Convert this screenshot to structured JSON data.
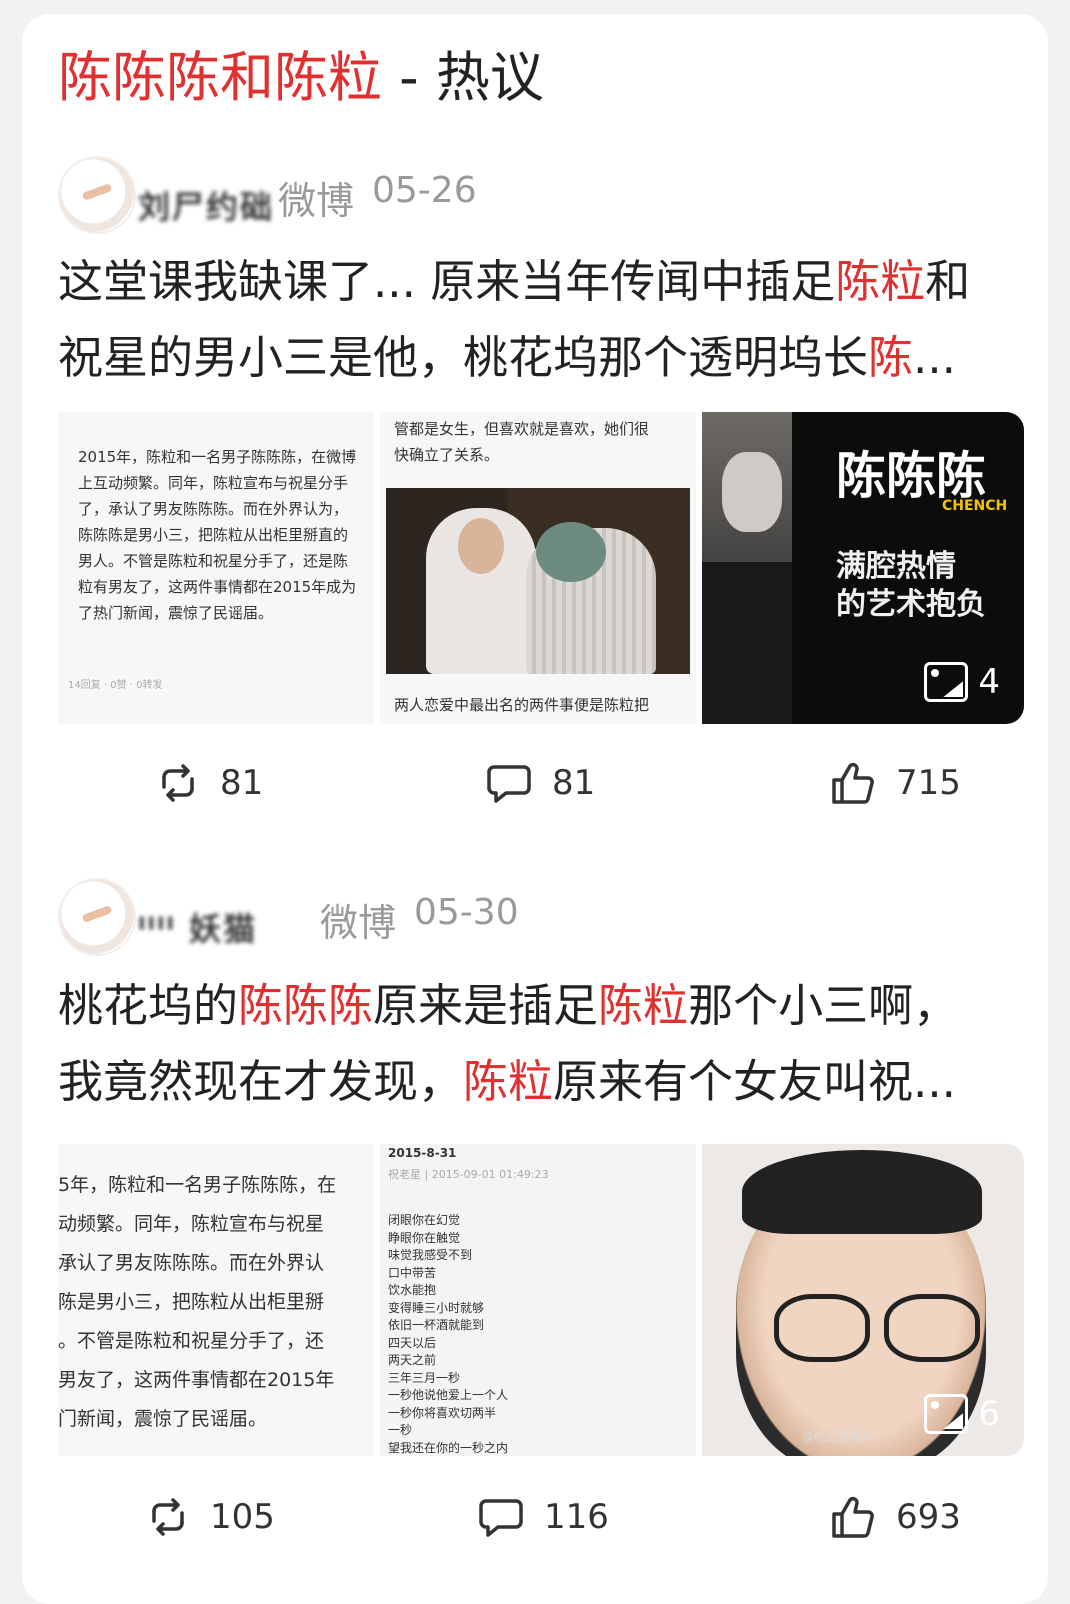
{
  "header": {
    "title_highlight": "陈陈陈和陈粒",
    "title_rest": " - 热议"
  },
  "posts": [
    {
      "user_name": "刘尸约础",
      "source": "微博",
      "date": "05-26",
      "text_lines": [
        [
          "这堂课我缺课了... 原来当年传闻中插足",
          "陈粒",
          "和"
        ],
        [
          "祝星的男小三是他，桃花坞那个透明坞长",
          "陈",
          "..."
        ]
      ],
      "images": {
        "doc1": [
          "2015年，陈粒和一名男子陈陈陈，在微博",
          "上互动频繁。同年，陈粒宣布与祝星分手",
          "了，承认了男友陈陈陈。而在外界认为，",
          "陈陈陈是男小三，把陈粒从出柜里掰直的",
          "男人。不管是陈粒和祝星分手了，还是陈",
          "粒有男友了，这两件事情都在2015年成为",
          "了热门新闻，震惊了民谣届。"
        ],
        "doc1_meta": "14回复 · 0赞 · 0转发",
        "doc2_top": [
          "管都是女生，但喜欢就是喜欢，她们很",
          "快确立了关系。"
        ],
        "doc2_bottom": "两人恋爱中最出名的两件事便是陈粒把",
        "poster_title": "陈陈陈",
        "poster_sub": "CHENCH",
        "poster_mid": [
          "满腔热情",
          "的艺术抱负"
        ],
        "image_count": "4"
      },
      "actions": {
        "repost": "81",
        "comment": "81",
        "like": "715"
      }
    },
    {
      "user_name": "ᴵᴵᴵᴵ 妖猫",
      "source": "微博",
      "date": "05-30",
      "text_lines": [
        [
          "桃花坞的",
          "陈陈陈",
          "原来是插足",
          "陈粒",
          "那个小三啊，"
        ],
        [
          "我竟然现在才发现，",
          "陈粒",
          "原来有个女友叫祝..."
        ]
      ],
      "images": {
        "doc1": [
          "5年，陈粒和一名男子陈陈陈，在",
          "动频繁。同年，陈粒宣布与祝星",
          "承认了男友陈陈陈。而在外界认",
          "陈是男小三，把陈粒从出柜里掰",
          "。不管是陈粒和祝星分手了，还",
          "男友了，这两件事情都在2015年",
          "门新闻，震惊了民谣届。"
        ],
        "doc2_date": "2015-8-31",
        "doc2_meta": "祝老星 | 2015-09-01 01:49:23",
        "doc2_poem": [
          "闭眼你在幻觉",
          "睁眼你在触觉",
          "味觉我感受不到",
          "口中带苦",
          "饮水能抱",
          "变得睡三小时就够",
          "依旧一杯酒就能到",
          "四天以后",
          "两天之前",
          "三年三月一秒",
          "一秒他说他爱上一个人",
          "一秒你将喜欢切两半",
          "一秒",
          "望我还在你的一秒之内"
        ],
        "watermark": "@吃瓜君爆料",
        "image_count": "6"
      },
      "actions": {
        "repost": "105",
        "comment": "116",
        "like": "693"
      }
    }
  ],
  "colors": {
    "highlight": "#e03030",
    "meta_gray": "#9a9a9a",
    "text": "#222222"
  },
  "icons": {
    "repost": "repost-icon",
    "comment": "comment-icon",
    "like": "thumbs-up-icon",
    "gallery": "image-gallery-icon"
  }
}
